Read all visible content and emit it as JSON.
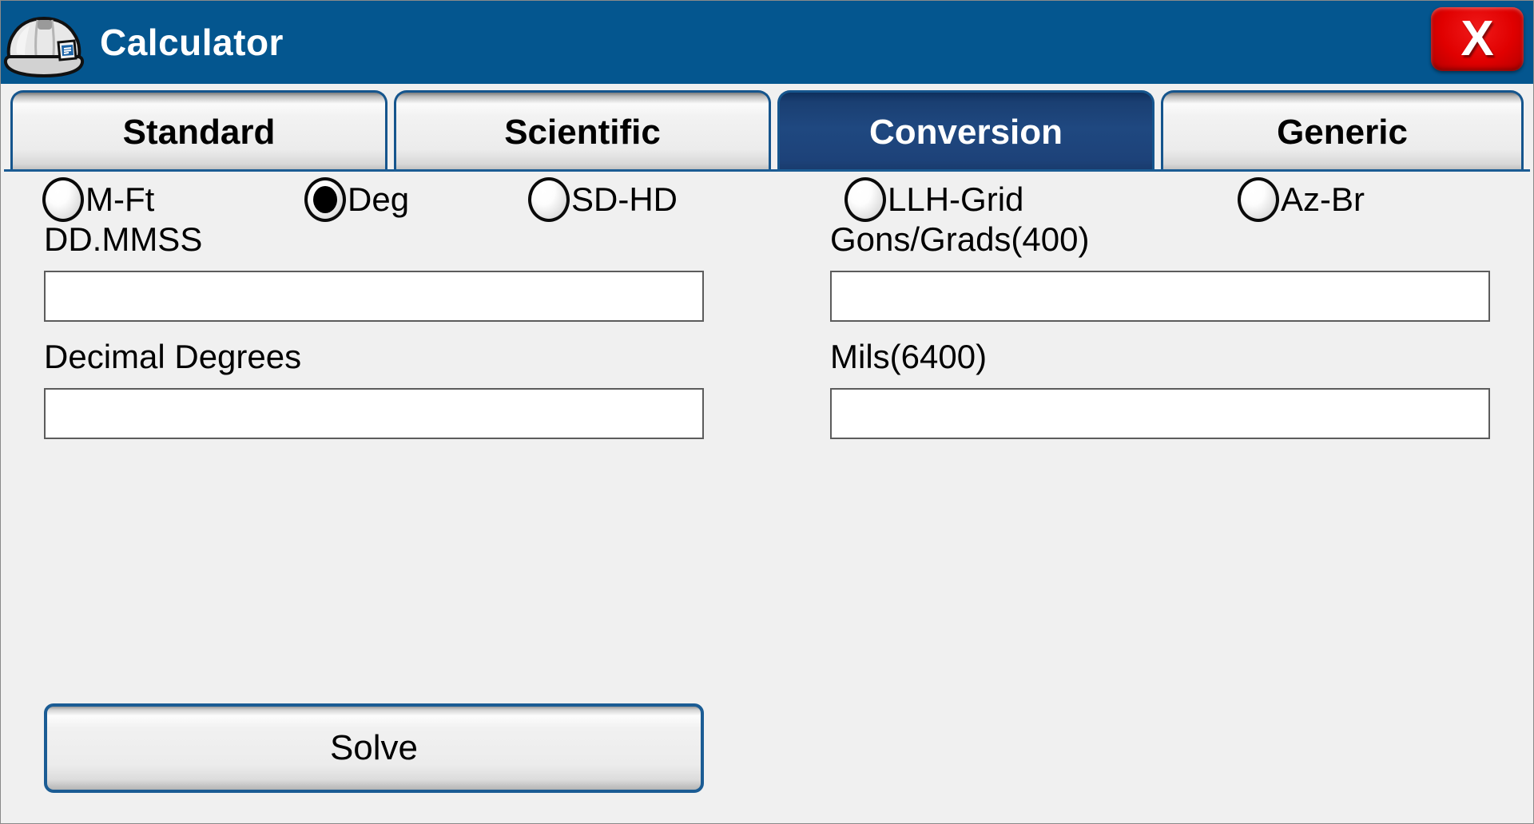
{
  "window": {
    "title": "Calculator",
    "icon": "hard-hat-icon",
    "close_label": "X",
    "titlebar_color": "#04568f",
    "accent_color": "#1b5c94",
    "close_color": "#d40000",
    "background_color": "#f0f0f0"
  },
  "tabs": [
    {
      "label": "Standard",
      "active": false
    },
    {
      "label": "Scientific",
      "active": false
    },
    {
      "label": "Conversion",
      "active": true
    },
    {
      "label": "Generic",
      "active": false
    }
  ],
  "conversion": {
    "radios": [
      {
        "label": "M-Ft",
        "checked": false
      },
      {
        "label": "Deg",
        "checked": true
      },
      {
        "label": "SD-HD",
        "checked": false
      },
      {
        "label": "LLH-Grid",
        "checked": false
      },
      {
        "label": "Az-Br",
        "checked": false
      }
    ],
    "fields": [
      {
        "label": "DD.MMSS",
        "value": "",
        "placeholder": ""
      },
      {
        "label": "Decimal Degrees",
        "value": "",
        "placeholder": ""
      },
      {
        "label": "Gons/Grads(400)",
        "value": "",
        "placeholder": ""
      },
      {
        "label": "Mils(6400)",
        "value": "",
        "placeholder": ""
      }
    ],
    "solve_label": "Solve"
  }
}
